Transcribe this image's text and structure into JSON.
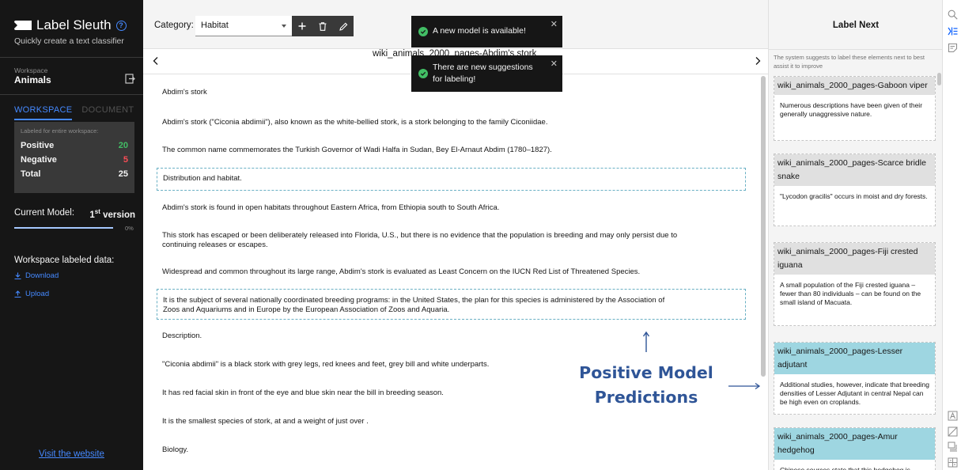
{
  "brand": {
    "title": "Label Sleuth",
    "tagline": "Quickly create a text classifier",
    "help_icon": "question-circle-icon"
  },
  "workspace": {
    "label": "Workspace",
    "name": "Animals"
  },
  "tabs": {
    "workspace": "WORKSPACE",
    "document": "DOCUMENT"
  },
  "stats": {
    "caption": "Labeled for entire workspace:",
    "positive_label": "Positive",
    "positive_value": "20",
    "negative_label": "Negative",
    "negative_value": "5",
    "total_label": "Total",
    "total_value": "25"
  },
  "model": {
    "label": "Current Model:",
    "version_num": "1",
    "version_suffix": "st",
    "version_word": " version",
    "progress_text": "0%",
    "progress": 0
  },
  "workspace_data": {
    "label": "Workspace labeled data:",
    "download": "Download",
    "upload": "Upload"
  },
  "visit_link": "Visit the website",
  "category": {
    "label": "Category:",
    "selected": "Habitat"
  },
  "document": {
    "title": "wiki_animals_2000_pages-Abdim's stork"
  },
  "examples": [
    {
      "text": "Abdim's stork",
      "predicted": false
    },
    {
      "text": "Abdim's stork (\"Ciconia abdimii\"), also known as the white-bellied stork, is a stork belonging to the family Ciconiidae.",
      "predicted": false
    },
    {
      "text": "The common name commemorates the Turkish Governor of Wadi Halfa in Sudan, Bey El-Arnaut Abdim (1780–1827).",
      "predicted": false
    },
    {
      "text": "Distribution and habitat.",
      "predicted": true
    },
    {
      "text": "Abdim's stork is found in open habitats throughout Eastern Africa, from Ethiopia south to South Africa.",
      "predicted": false
    },
    {
      "text": "This stork has escaped or been deliberately released into Florida, U.S., but there is no evidence that the population is breeding and may only persist due to continuing releases or escapes.",
      "predicted": false
    },
    {
      "text": "Widespread and common throughout its large range, Abdim's stork is evaluated as Least Concern on the IUCN Red List of Threatened Species.",
      "predicted": false
    },
    {
      "text": "It is the subject of several nationally coordinated breeding programs: in the United States, the plan for this species is administered by the Association of Zoos and Aquariums and in Europe by the European Association of Zoos and Aquaria.",
      "predicted": true
    },
    {
      "text": "Description.",
      "predicted": false
    },
    {
      "text": "\"Ciconia abdimii\" is a black stork with grey legs, red knees and feet, grey bill and white underparts.",
      "predicted": false
    },
    {
      "text": "It has red facial skin in front of the eye and blue skin near the bill in breeding season.",
      "predicted": false
    },
    {
      "text": "It is the smallest species of stork, at and a weight of just over .",
      "predicted": false
    },
    {
      "text": "Biology.",
      "predicted": false
    }
  ],
  "toasts": [
    {
      "message": "A new model is available!"
    },
    {
      "message": "There are new suggestions for labeling!"
    }
  ],
  "annotation": {
    "line1": "Positive Model",
    "line2": "Predictions"
  },
  "label_next": {
    "title": "Label Next",
    "description": "The system suggests to label these elements next to best assist it to improve",
    "items": [
      {
        "title": "wiki_animals_2000_pages-Gaboon viper",
        "text": "Numerous descriptions have been given of their generally unaggressive nature.",
        "positive": false
      },
      {
        "title": "wiki_animals_2000_pages-Scarce bridle snake",
        "text": "\"Lycodon gracilis\" occurs in moist and dry forests.",
        "positive": false
      },
      {
        "title": "wiki_animals_2000_pages-Fiji crested iguana",
        "text": "A small population of the Fiji crested iguana – fewer than 80 individuals – can be found on the small island of Macuata.",
        "positive": false
      },
      {
        "title": "wiki_animals_2000_pages-Lesser adjutant",
        "text": "Additional studies, however, indicate that breeding densities of Lesser Adjutant in central Nepal can be high even on croplands.",
        "positive": true
      },
      {
        "title": "wiki_animals_2000_pages-Amur hedgehog",
        "text": "Chinese sources state that this hedgehog is preyed on by sable (\"Martes zibellina\"), but",
        "positive": true
      }
    ]
  },
  "colors": {
    "sidebar_bg": "#161616",
    "accent": "#4589ff",
    "positive": "#42be65",
    "negative": "#fa4d56",
    "positive_prediction": "#9ed6e1",
    "annotation": "#2f5597"
  }
}
